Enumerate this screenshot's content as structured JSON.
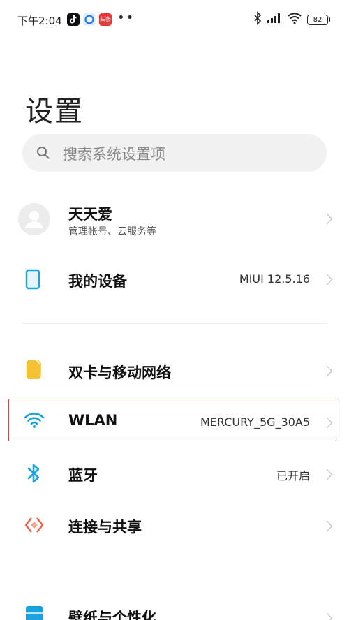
{
  "status_bar": {
    "time": "下午2:04",
    "app_icons": [
      "tiktok-icon",
      "browser-icon",
      "toutiao-icon"
    ],
    "toutiao_text": "头条",
    "more": "••",
    "battery": "82",
    "icons": [
      "bluetooth-icon",
      "signal-icon",
      "wifi-icon",
      "battery-icon"
    ]
  },
  "page": {
    "title": "设置"
  },
  "search": {
    "placeholder": "搜索系统设置项"
  },
  "account": {
    "name": "天天爱",
    "subtitle": "管理帐号、云服务等"
  },
  "items": [
    {
      "id": "my-device",
      "label": "我的设备",
      "value": "MIUI 12.5.16",
      "icon": "phone-outline-icon",
      "color": "#1aa3e0"
    },
    {
      "id": "sim",
      "label": "双卡与移动网络",
      "value": "",
      "icon": "sim-card-icon",
      "color": "#f5c231"
    },
    {
      "id": "wlan",
      "label": "WLAN",
      "value": "MERCURY_5G_30A5",
      "icon": "wifi-icon",
      "color": "#1aa3e0"
    },
    {
      "id": "bluetooth",
      "label": "蓝牙",
      "value": "已开启",
      "icon": "bluetooth-icon",
      "color": "#1aa3e0"
    },
    {
      "id": "connection",
      "label": "连接与共享",
      "value": "",
      "icon": "share-diamond-icon",
      "color": "#f0624a"
    },
    {
      "id": "wallpaper",
      "label": "壁纸与个性化",
      "value": "",
      "icon": "wallpaper-icon",
      "color": "#1aa3e0"
    }
  ],
  "highlight_color": "#c9484a"
}
